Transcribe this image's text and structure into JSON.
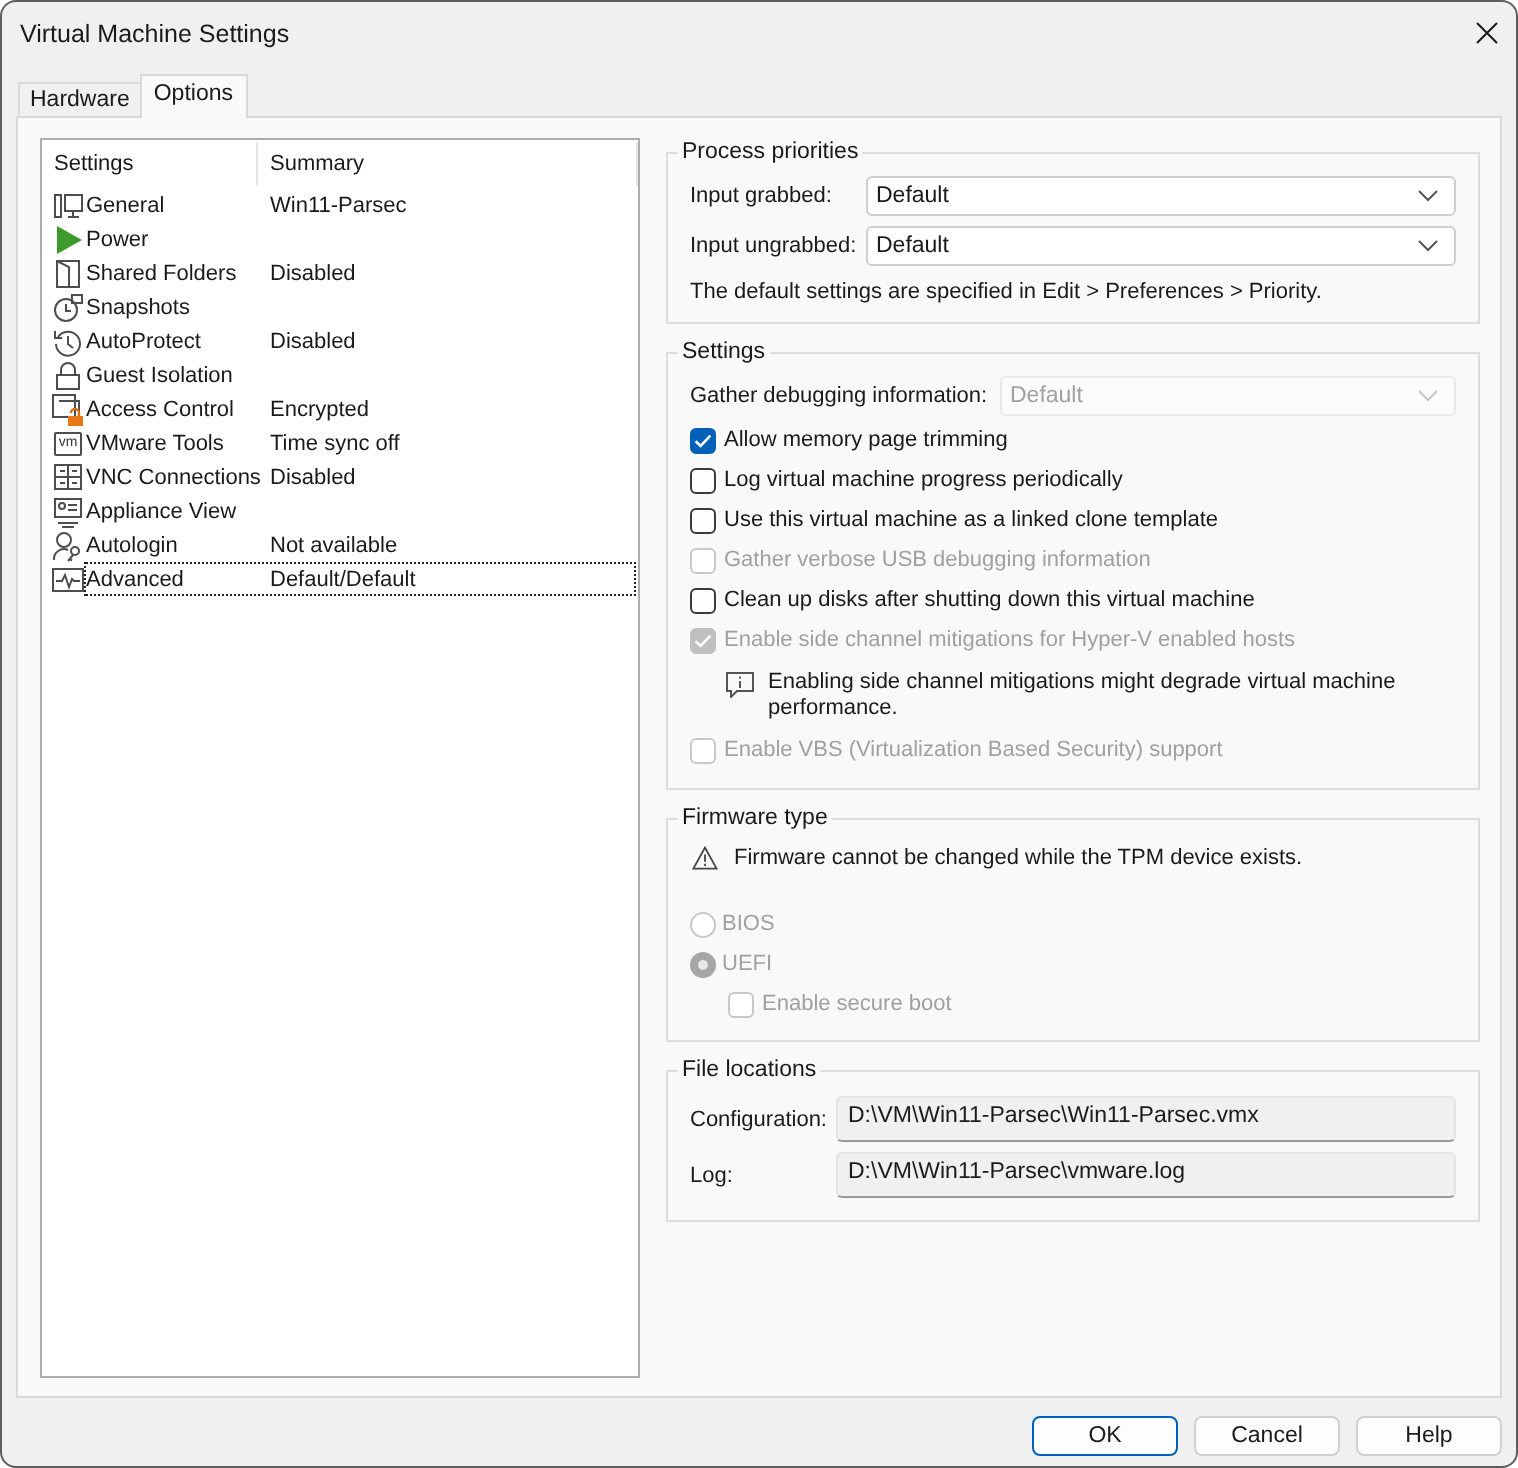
{
  "window": {
    "title": "Virtual Machine Settings"
  },
  "tabs": [
    {
      "label": "Hardware",
      "selected": false
    },
    {
      "label": "Options",
      "selected": true
    }
  ],
  "settings_list": {
    "columns": [
      "Settings",
      "Summary"
    ],
    "items": [
      {
        "name": "General",
        "summary": "Win11-Parsec",
        "selected": false
      },
      {
        "name": "Power",
        "selected": false
      },
      {
        "name": "Shared Folders",
        "summary": "Disabled",
        "selected": false
      },
      {
        "name": "Snapshots",
        "selected": false
      },
      {
        "name": "AutoProtect",
        "summary": "Disabled",
        "selected": false
      },
      {
        "name": "Guest Isolation",
        "selected": false
      },
      {
        "name": "Access Control",
        "summary": "Encrypted",
        "selected": false
      },
      {
        "name": "VMware Tools",
        "summary": "Time sync off",
        "icon_text": "vm",
        "selected": false
      },
      {
        "name": "VNC Connections",
        "summary": "Disabled",
        "selected": false
      },
      {
        "name": "Appliance View",
        "selected": false
      },
      {
        "name": "Autologin",
        "summary": "Not available",
        "selected": false
      },
      {
        "name": "Advanced",
        "summary": "Default/Default",
        "selected": true
      }
    ]
  },
  "process_priorities": {
    "title": "Process priorities",
    "fields": [
      {
        "label": "Input grabbed:",
        "value": "Default"
      },
      {
        "label": "Input ungrabbed:",
        "value": "Default"
      }
    ],
    "note": "The default settings are specified in Edit > Preferences > Priority."
  },
  "settings": {
    "title": "Settings",
    "debug_field": {
      "label": "Gather debugging information:",
      "value": "Default",
      "disabled": true
    },
    "options": [
      {
        "kind": "checkbox",
        "label": "Allow memory page trimming",
        "checked": true,
        "disabled": false
      },
      {
        "kind": "checkbox",
        "label": "Log virtual machine progress periodically",
        "checked": false,
        "disabled": false
      },
      {
        "kind": "checkbox",
        "label": "Use this virtual machine as a linked clone template",
        "checked": false,
        "disabled": false
      },
      {
        "kind": "checkbox",
        "label": "Gather verbose USB debugging information",
        "checked": false,
        "disabled": true
      },
      {
        "kind": "checkbox",
        "label": "Clean up disks after shutting down this virtual machine",
        "checked": false,
        "disabled": false
      },
      {
        "kind": "checkbox",
        "label": "Enable side channel mitigations for Hyper-V enabled hosts",
        "checked": true,
        "disabled": true
      },
      {
        "kind": "info",
        "text": "Enabling side channel mitigations might degrade virtual machine performance."
      },
      {
        "kind": "checkbox",
        "label": "Enable VBS (Virtualization Based Security) support",
        "checked": false,
        "disabled": true
      }
    ]
  },
  "firmware": {
    "title": "Firmware type",
    "warning": "Firmware cannot be changed while the TPM device exists.",
    "options": [
      {
        "label": "BIOS",
        "selected": false,
        "disabled": true
      },
      {
        "label": "UEFI",
        "selected": true,
        "disabled": true
      }
    ],
    "secure_boot": {
      "label": "Enable secure boot",
      "checked": false,
      "disabled": true
    }
  },
  "file_locations": {
    "title": "File locations",
    "fields": [
      {
        "label": "Configuration:",
        "value": "D:\\VM\\Win11-Parsec\\Win11-Parsec.vmx"
      },
      {
        "label": "Log:",
        "value": "D:\\VM\\Win11-Parsec\\vmware.log"
      }
    ]
  },
  "buttons": [
    {
      "label": "OK",
      "default": true
    },
    {
      "label": "Cancel",
      "default": false
    },
    {
      "label": "Help",
      "default": false
    }
  ]
}
